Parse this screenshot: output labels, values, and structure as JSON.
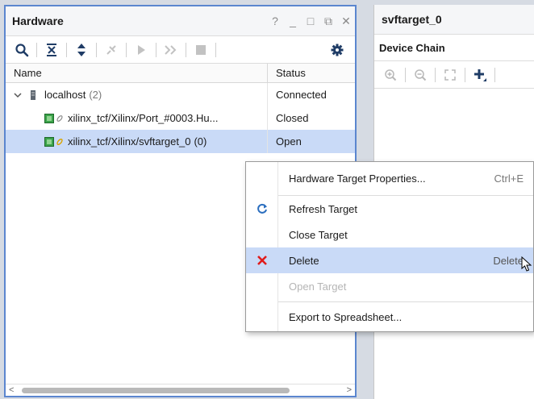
{
  "hardware": {
    "title": "Hardware",
    "controls": [
      "?",
      "_",
      "□",
      "⧉",
      "✕"
    ],
    "columns": {
      "name": "Name",
      "status": "Status"
    },
    "rows": [
      {
        "name": "localhost",
        "count": "(2)",
        "status": "Connected"
      },
      {
        "name": "xilinx_tcf/Xilinx/Port_#0003.Hu...",
        "count": "",
        "status": "Closed"
      },
      {
        "name": "xilinx_tcf/Xilinx/svftarget_0",
        "count": "(0)",
        "status": "Open"
      }
    ]
  },
  "target_panel": {
    "title": "svftarget_0",
    "subtitle": "Device Chain"
  },
  "context_menu": {
    "items": [
      {
        "label": "Hardware Target Properties...",
        "shortcut": "Ctrl+E"
      },
      {
        "label": "Refresh Target",
        "shortcut": ""
      },
      {
        "label": "Close Target",
        "shortcut": ""
      },
      {
        "label": "Delete",
        "shortcut": "Delete"
      },
      {
        "label": "Open Target",
        "shortcut": ""
      },
      {
        "label": "Export to Spreadsheet...",
        "shortcut": ""
      }
    ]
  },
  "colors": {
    "selection": "#c9daf7",
    "panel_border": "#5b86cf",
    "delete_icon": "#e01b1b",
    "refresh_icon": "#2c6fbf",
    "chip": "#3aa24a"
  },
  "icons": {
    "toolbar": [
      "search-icon",
      "collapse-all-icon",
      "expand-all-icon",
      "auto-connect-icon",
      "run-icon",
      "forward-icon",
      "stop-icon",
      "settings-gear-icon"
    ],
    "target_toolbar": [
      "zoom-in-icon",
      "zoom-out-icon",
      "fit-icon",
      "add-icon"
    ]
  }
}
